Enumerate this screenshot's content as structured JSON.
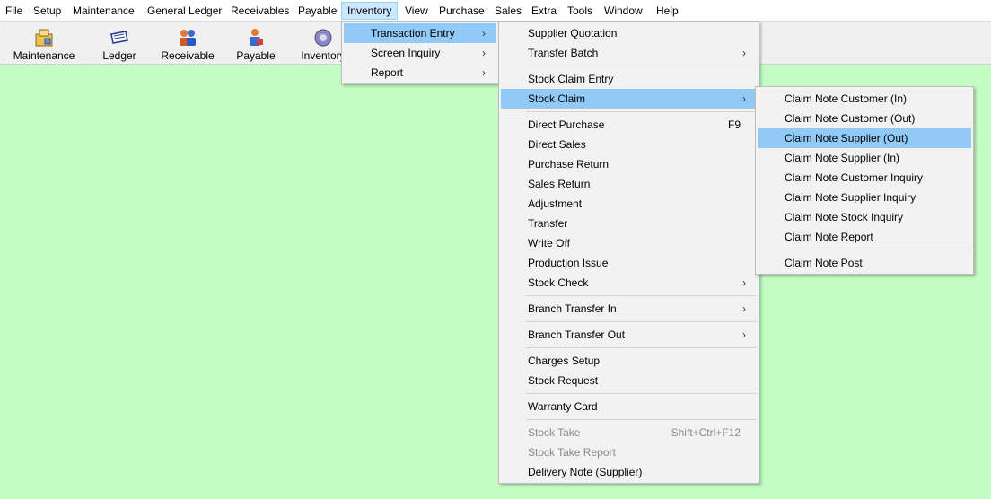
{
  "menubar": {
    "items": [
      "File",
      "Setup",
      "Maintenance",
      "General Ledger",
      "Receivables",
      "Payable",
      "Inventory",
      "View",
      "Purchase",
      "Sales",
      "Extra",
      "Tools",
      "Window",
      "Help"
    ],
    "active": "Inventory"
  },
  "toolbar": {
    "buttons": [
      {
        "label": "Maintenance",
        "icon": "maintenance-icon"
      },
      {
        "label": "Ledger",
        "icon": "ledger-icon"
      },
      {
        "label": "Receivable",
        "icon": "receivable-icon"
      },
      {
        "label": "Payable",
        "icon": "payable-icon"
      },
      {
        "label": "Inventory",
        "icon": "gear-icon"
      }
    ]
  },
  "inventory_menu": {
    "items": [
      {
        "label": "Transaction Entry",
        "submenu": true,
        "highlighted": true
      },
      {
        "label": "Screen Inquiry",
        "submenu": true
      },
      {
        "label": "Report",
        "submenu": true
      }
    ]
  },
  "transaction_menu": {
    "items": [
      {
        "label": "Supplier Quotation"
      },
      {
        "label": "Transfer Batch",
        "submenu": true
      },
      {
        "label": "Stock Claim Entry"
      },
      {
        "label": "Stock Claim",
        "submenu": true,
        "highlighted": true
      },
      {
        "label": "Direct Purchase",
        "shortcut": "F9"
      },
      {
        "label": "Direct Sales"
      },
      {
        "label": "Purchase Return"
      },
      {
        "label": "Sales Return"
      },
      {
        "label": "Adjustment"
      },
      {
        "label": "Transfer"
      },
      {
        "label": "Write Off"
      },
      {
        "label": "Production Issue"
      },
      {
        "label": "Stock Check",
        "submenu": true
      },
      {
        "label": "Branch Transfer In",
        "submenu": true
      },
      {
        "label": "Branch Transfer Out",
        "submenu": true
      },
      {
        "label": "Charges Setup"
      },
      {
        "label": "Stock Request"
      },
      {
        "label": "Warranty Card"
      },
      {
        "label": "Stock Take",
        "shortcut": "Shift+Ctrl+F12",
        "disabled": true
      },
      {
        "label": "Stock Take Report",
        "disabled": true
      },
      {
        "label": "Delivery Note (Supplier)"
      }
    ]
  },
  "stock_claim_menu": {
    "items": [
      {
        "label": "Claim Note Customer (In)"
      },
      {
        "label": "Claim Note Customer (Out)"
      },
      {
        "label": "Claim Note Supplier (Out)",
        "highlighted": true
      },
      {
        "label": "Claim Note Supplier (In)"
      },
      {
        "label": "Claim Note Customer Inquiry"
      },
      {
        "label": "Claim Note Supplier Inquiry"
      },
      {
        "label": "Claim Note Stock Inquiry"
      },
      {
        "label": "Claim Note Report"
      },
      {
        "label": "Claim Note Post"
      }
    ]
  },
  "colors": {
    "desktop": "#c3fdc3",
    "highlight": "#91c9f7",
    "menubar_active": "#cce8ff"
  }
}
